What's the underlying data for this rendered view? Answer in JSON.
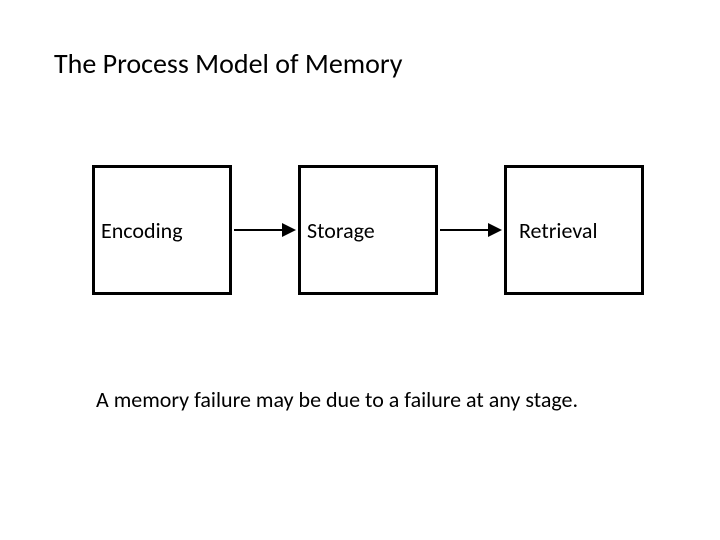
{
  "title": "The Process Model of Memory",
  "boxes": {
    "encoding": "Encoding",
    "storage": "Storage",
    "retrieval": "Retrieval"
  },
  "caption": "A memory failure may be due to a failure at any stage."
}
